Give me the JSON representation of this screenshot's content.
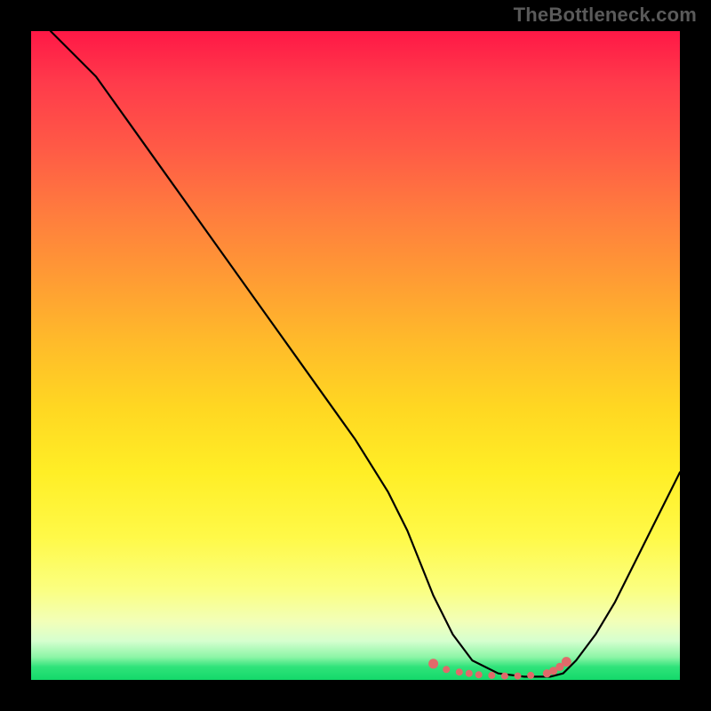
{
  "watermark": "TheBottleneck.com",
  "colors": {
    "background": "#000000",
    "gradient_top": "#ff1846",
    "gradient_bottom": "#14d96a",
    "curve": "#000000",
    "markers": "#e06a6a"
  },
  "chart_data": {
    "type": "line",
    "title": "",
    "xlabel": "",
    "ylabel": "",
    "xlim": [
      0,
      100
    ],
    "ylim": [
      0,
      100
    ],
    "note": "Axes are inferred (no labels drawn). Higher y = top of plot. Curve appears to show a bottleneck-style V shape reaching ~0 near x≈70; values are estimated from pixel positions.",
    "series": [
      {
        "name": "curve",
        "x": [
          3,
          6,
          10,
          15,
          20,
          25,
          30,
          35,
          40,
          45,
          50,
          55,
          58,
          60,
          62,
          65,
          68,
          72,
          76,
          80,
          82,
          84,
          87,
          90,
          93,
          96,
          100
        ],
        "y": [
          100,
          97,
          93,
          86,
          79,
          72,
          65,
          58,
          51,
          44,
          37,
          29,
          23,
          18,
          13,
          7,
          3,
          1,
          0.5,
          0.5,
          1,
          3,
          7,
          12,
          18,
          24,
          32
        ]
      }
    ],
    "markers": {
      "name": "optimal-range",
      "note": "pink dotted markers along the trough, y≈0.5–2",
      "points": [
        {
          "x": 62,
          "y": 2.5
        },
        {
          "x": 64,
          "y": 1.6
        },
        {
          "x": 66,
          "y": 1.2
        },
        {
          "x": 67.5,
          "y": 1.0
        },
        {
          "x": 69,
          "y": 0.8
        },
        {
          "x": 71,
          "y": 0.7
        },
        {
          "x": 73,
          "y": 0.6
        },
        {
          "x": 75,
          "y": 0.6
        },
        {
          "x": 77,
          "y": 0.7
        },
        {
          "x": 79.5,
          "y": 1.0
        },
        {
          "x": 80.5,
          "y": 1.4
        },
        {
          "x": 81.5,
          "y": 2.0
        },
        {
          "x": 82.5,
          "y": 2.8
        }
      ]
    }
  }
}
